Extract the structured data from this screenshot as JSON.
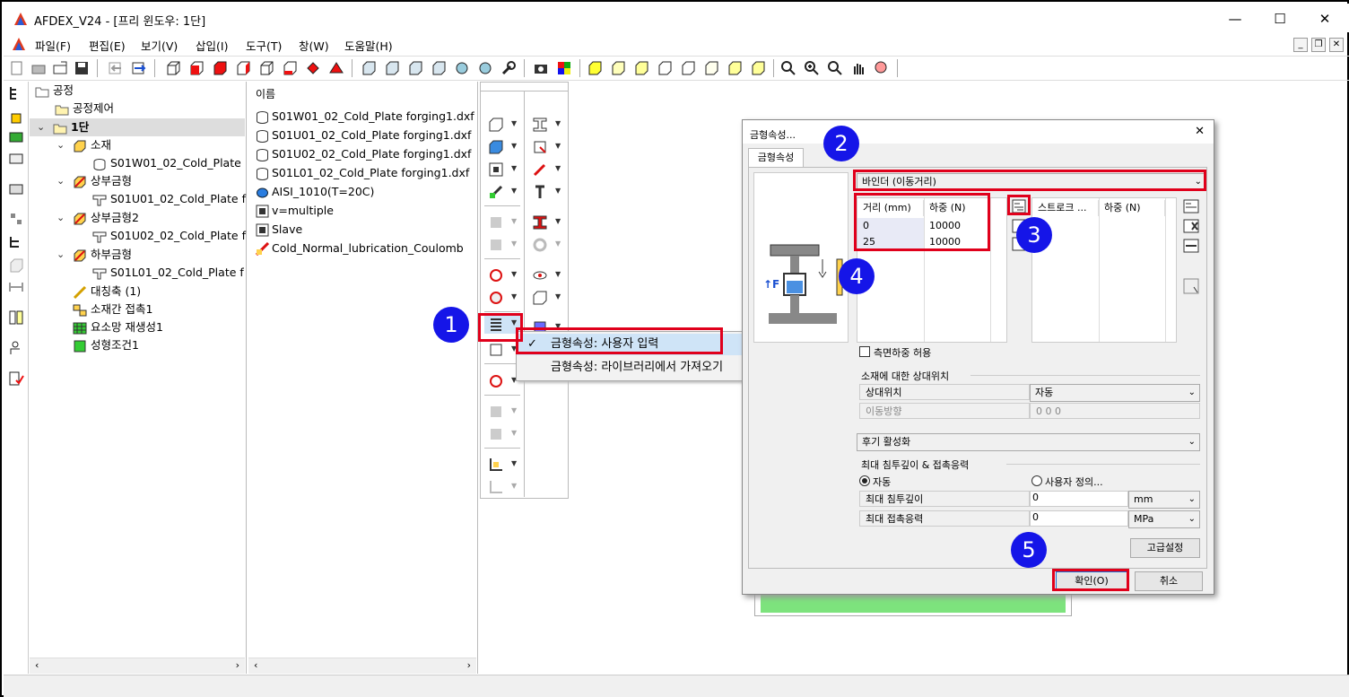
{
  "window": {
    "title": "AFDEX_V24 - [프리 윈도우: 1단]",
    "min": "—",
    "max": "☐",
    "close": "✕"
  },
  "menu": [
    "파일(F)",
    "편집(E)",
    "보기(V)",
    "삽입(I)",
    "도구(T)",
    "창(W)",
    "도움말(H)"
  ],
  "mdi": {
    "min": "_",
    "restore": "❐",
    "close": "✕"
  },
  "tree": {
    "root": "공정",
    "process_control": "공정제어",
    "stage": "1단",
    "material": "소재",
    "material_file": "S01W01_02_Cold_Plate",
    "upper_die": "상부금형",
    "upper_die_file": "S01U01_02_Cold_Plate f",
    "upper_die2": "상부금형2",
    "upper_die2_file": "S01U02_02_Cold_Plate f",
    "lower_die": "하부금형",
    "lower_die_file": "S01L01_02_Cold_Plate f",
    "symmetry": "대칭축 (1)",
    "contact": "소재간 접촉1",
    "remesh": "요소망 재생성1",
    "conditions": "성형조건1"
  },
  "files": {
    "header": "이름",
    "items": [
      "S01W01_02_Cold_Plate forging1.dxf",
      "S01U01_02_Cold_Plate forging1.dxf",
      "S01U02_02_Cold_Plate forging1.dxf",
      "S01L01_02_Cold_Plate forging1.dxf",
      "AISI_1010(T=20C)",
      "v=multiple",
      "Slave",
      "Cold_Normal_lubrication_Coulomb"
    ]
  },
  "popup": {
    "item1": "금형속성: 사용자 입력",
    "item1_check": "✓",
    "item2": "금형속성: 라이브러리에서 가져오기"
  },
  "dialog": {
    "title": "금형속성...",
    "close": "✕",
    "tab": "금형속성",
    "binder_combo": "바인더 (이동거리)",
    "table1_headers": [
      "거리 (mm)",
      "하중 (N)"
    ],
    "table1_rows": [
      [
        "0",
        "10000"
      ],
      [
        "25",
        "10000"
      ]
    ],
    "table2_headers": [
      "스트로크 ...",
      "하중 (N)"
    ],
    "side_load_label": "측면하중 허용",
    "relpos_group": "소재에 대한 상대위치",
    "relpos_label": "상대위치",
    "relpos_value": "자동",
    "movedir_label": "이동방향",
    "movedir_value": "0 0 0",
    "activation_combo": "후기 활성화",
    "pen_group": "최대 침투깊이 & 접촉응력",
    "auto_label": "자동",
    "user_label": "사용자 정의...",
    "maxpen_label": "최대 침투깊이",
    "maxpen_value": "0",
    "maxpen_unit": "mm",
    "maxstress_label": "최대 접촉응력",
    "maxstress_value": "0",
    "maxstress_unit": "MPa",
    "advanced_btn": "고급설정",
    "ok_btn": "확인(O)",
    "cancel_btn": "취소"
  },
  "markers": [
    "1",
    "2",
    "3",
    "4",
    "5"
  ],
  "colors": {
    "highlight_red": "#e0001b",
    "marker_blue": "#1515e8",
    "progress_green": "#7de37d"
  }
}
